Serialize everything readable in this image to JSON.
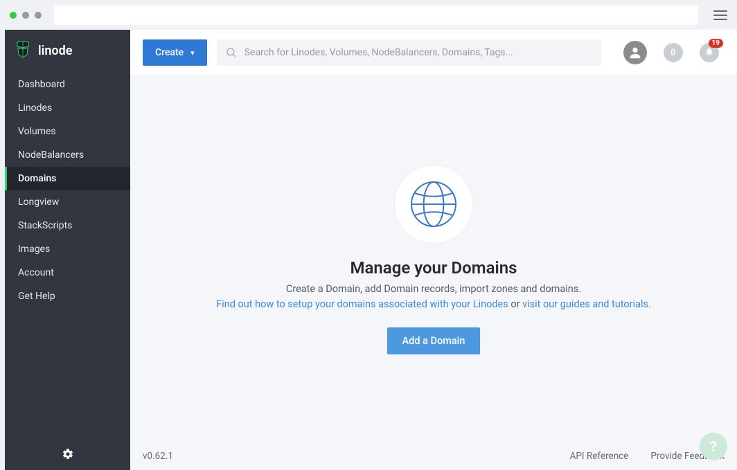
{
  "brand": {
    "name": "linode"
  },
  "sidebar": {
    "items": [
      {
        "label": "Dashboard"
      },
      {
        "label": "Linodes"
      },
      {
        "label": "Volumes"
      },
      {
        "label": "NodeBalancers"
      },
      {
        "label": "Domains"
      },
      {
        "label": "Longview"
      },
      {
        "label": "StackScripts"
      },
      {
        "label": "Images"
      },
      {
        "label": "Account"
      },
      {
        "label": "Get Help"
      }
    ],
    "active_index": 4
  },
  "topbar": {
    "create_label": "Create",
    "search_placeholder": "Search for Linodes, Volumes, NodeBalancers, Domains, Tags...",
    "credit_value": "0",
    "notification_count": "19"
  },
  "empty_state": {
    "headline": "Manage your Domains",
    "subline1": "Create a Domain, add Domain records, import zones and domains.",
    "link1": "Find out how to setup your domains associated with your Linodes",
    "or_text": " or ",
    "link2": "visit our guides and tutorials.",
    "cta": "Add a Domain"
  },
  "footer": {
    "version": "v0.62.1",
    "api_ref": "API Reference",
    "feedback": "Provide Feedback"
  },
  "help_fab": "?"
}
